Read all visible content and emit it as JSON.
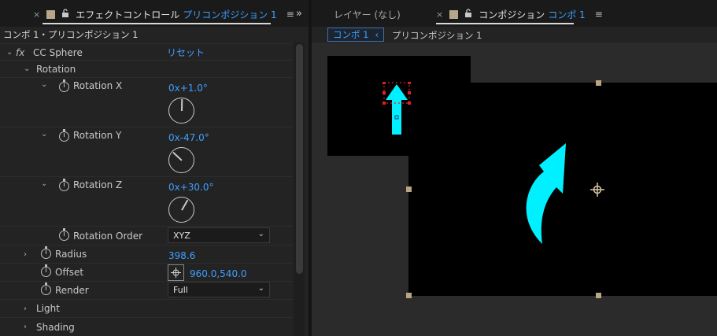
{
  "left_panel": {
    "tab": {
      "title": "エフェクトコントロール",
      "layer_name": "プリコンポジション 1"
    },
    "layer_path": "コンポ 1・プリコンポジション 1",
    "effect": {
      "fx_label": "fx",
      "name": "CC Sphere",
      "reset_label": "リセット"
    },
    "rotation_group_label": "Rotation",
    "rotation_x": {
      "label": "Rotation X",
      "value": "0x+1.0°",
      "angle_deg": 1
    },
    "rotation_y": {
      "label": "Rotation Y",
      "value": "0x-47.0°",
      "angle_deg": -47
    },
    "rotation_z": {
      "label": "Rotation Z",
      "value": "0x+30.0°",
      "angle_deg": 30
    },
    "rotation_order": {
      "label": "Rotation Order",
      "selected": "XYZ"
    },
    "radius": {
      "label": "Radius",
      "value": "398.6"
    },
    "offset": {
      "label": "Offset",
      "value": "960.0,540.0"
    },
    "render": {
      "label": "Render",
      "selected": "Full"
    },
    "light_label": "Light",
    "shading_label": "Shading"
  },
  "right_panel": {
    "layer_tab": "レイヤー (なし)",
    "comp_tab": {
      "title": "コンポジション",
      "comp_name": "コンポ 1"
    },
    "breadcrumb": {
      "active": "コンポ 1",
      "next": "プリコンポジション 1"
    }
  },
  "icons": {
    "close": "×",
    "lock": "🔓",
    "menu": "≡",
    "collapse": "»",
    "twirl_open": "⌄",
    "twirl_closed": "›",
    "breadcrumb_back": "‹"
  },
  "colors": {
    "accent_blue": "#3da0ff",
    "arrow_cyan": "#00f0ff",
    "handle": "#b8a585",
    "layer_color_chip": "#b6a78a"
  }
}
